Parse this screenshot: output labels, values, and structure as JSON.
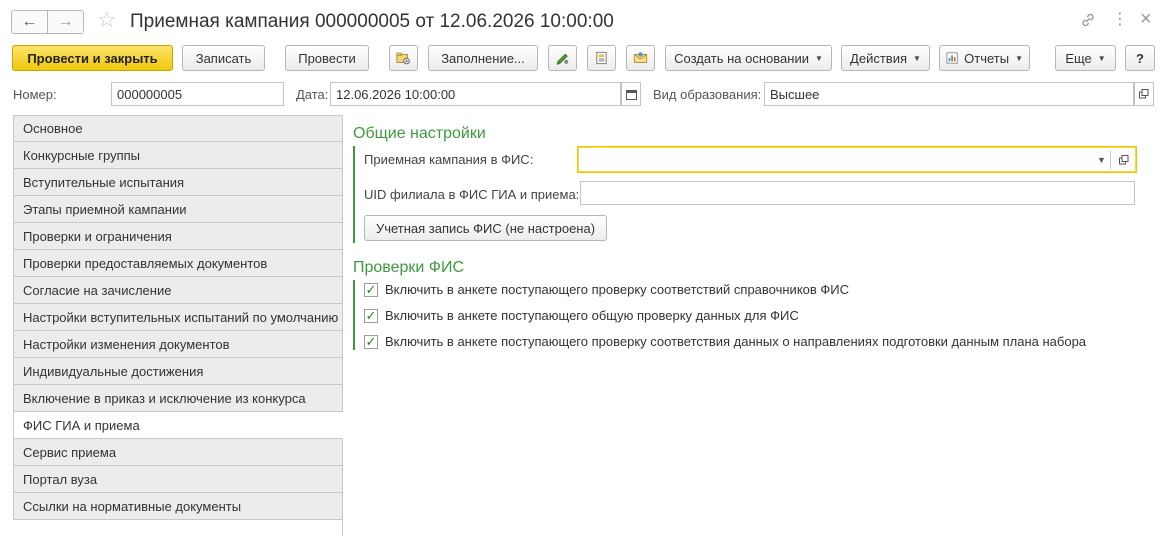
{
  "window": {
    "title": "Приемная кампания 000000005 от 12.06.2026 10:00:00",
    "back_icon": "←",
    "forward_icon": "→",
    "star_icon": "☆",
    "link_icon": "🔗",
    "more_icon": "⋮",
    "close_icon": "×"
  },
  "toolbar": {
    "post_and_close": "Провести и закрыть",
    "save": "Записать",
    "post": "Провести",
    "fill": "Заполнение...",
    "create_based_on": "Создать на основании",
    "actions": "Действия",
    "reports": "Отчеты",
    "more": "Еще",
    "help": "?",
    "caret": "▼"
  },
  "header": {
    "number_label": "Номер:",
    "number_value": "000000005",
    "date_label": "Дата:",
    "date_value": "12.06.2026 10:00:00",
    "education_label": "Вид образования:",
    "education_value": "Высшее"
  },
  "sidebar": {
    "items": [
      {
        "label": "Основное"
      },
      {
        "label": "Конкурсные группы"
      },
      {
        "label": "Вступительные испытания"
      },
      {
        "label": "Этапы приемной кампании"
      },
      {
        "label": "Проверки и ограничения"
      },
      {
        "label": "Проверки предоставляемых документов"
      },
      {
        "label": "Согласие на зачисление"
      },
      {
        "label": "Настройки вступительных испытаний по умолчанию"
      },
      {
        "label": "Настройки изменения документов"
      },
      {
        "label": "Индивидуальные достижения"
      },
      {
        "label": "Включение в приказ и исключение из конкурса"
      },
      {
        "label": "ФИС ГИА и приема",
        "active": true
      },
      {
        "label": "Сервис приема"
      },
      {
        "label": "Портал вуза"
      },
      {
        "label": "Ссылки на нормативные документы"
      }
    ]
  },
  "general": {
    "title": "Общие настройки",
    "campaign_label": "Приемная кампания в ФИС:",
    "campaign_value": "",
    "uid_label": "UID филиала в ФИС ГИА и приема:",
    "uid_value": "",
    "account_button": "Учетная запись ФИС (не настроена)"
  },
  "checks": {
    "title": "Проверки ФИС",
    "items": [
      {
        "label": "Включить в анкете поступающего проверку соответствий справочников ФИС",
        "checked": true
      },
      {
        "label": "Включить в анкете поступающего общую проверку данных для ФИС",
        "checked": true
      },
      {
        "label": "Включить в анкете поступающего проверку соответствия данных о направлениях подготовки данным плана набора",
        "checked": true
      }
    ]
  },
  "colors": {
    "accent_green": "#3f9a3f",
    "primary_yellow": "#f1c90c",
    "focus_yellow": "#f0c400"
  }
}
